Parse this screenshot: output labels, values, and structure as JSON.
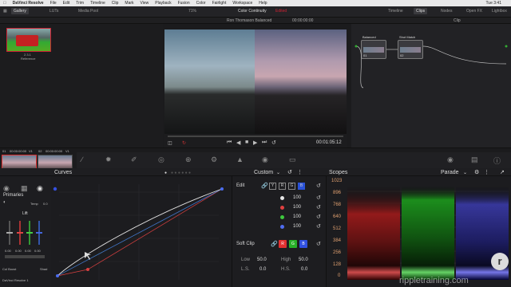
{
  "menubar": {
    "app": "DaVinci Resolve",
    "items": [
      "File",
      "Edit",
      "Trim",
      "Timeline",
      "Clip",
      "Mark",
      "View",
      "Playback",
      "Fusion",
      "Color",
      "Fairlight",
      "Workspace",
      "Help"
    ],
    "clock": "Tue 3:41"
  },
  "toolbar": {
    "gallery": "Gallery",
    "luts": "LUTs",
    "media_pool": "Media Pool",
    "zoom": "71%",
    "title": "Color Continuity",
    "edited": "Edited",
    "timeline": "Timeline",
    "clips": "Clips",
    "nodes": "Nodes",
    "openfx": "Open FX",
    "lightbox": "Lightbox"
  },
  "subbar": {
    "clip_name": "Ron Thomason Balanced",
    "timecode": "00:00:00:00",
    "mode": "Clip"
  },
  "gallery": {
    "still_id": "2.3.1",
    "still_label": "Reference"
  },
  "viewer": {
    "timecode": "00:01:05:12"
  },
  "nodes": {
    "node1_label": "Balanced",
    "node1_num": "01",
    "node2_label": "Shot Match",
    "node2_num": "02"
  },
  "clips": {
    "c1_num": "01",
    "c1_tc": "00:00:00:00",
    "c1_track": "V1",
    "c1_name": "Drone Evening A.mov",
    "c2_num": "02",
    "c2_tc": "00:00:00:00",
    "c2_track": "V1",
    "c2_name": "Drone"
  },
  "primaries": {
    "title": "Primaries",
    "temp_label": "Temp",
    "temp_value": "0.0",
    "lift_label": "Lift",
    "lift_values": [
      "0.00",
      "0.00",
      "0.00",
      "0.00"
    ],
    "col_boost": "Col Boost",
    "shad": "Shad",
    "footer": "DaVinci Resolve 1"
  },
  "curves": {
    "title": "Curves",
    "mode": "Custom"
  },
  "edit": {
    "title": "Edit",
    "channels": [
      "Y",
      "R",
      "G",
      "B"
    ],
    "values": [
      "100",
      "100",
      "100",
      "100"
    ],
    "channel_colors": [
      "#e6e6e6",
      "#e04040",
      "#3ec83e",
      "#4f6cf0"
    ]
  },
  "softclip": {
    "title": "Soft Clip",
    "channels": [
      "R",
      "G",
      "B"
    ],
    "channel_colors": [
      "#e03030",
      "#28b028",
      "#3050e0"
    ],
    "low_label": "Low",
    "low_value": "50.0",
    "high_label": "High",
    "high_value": "50.0",
    "ls_label": "L.S.",
    "ls_value": "0.0",
    "hs_label": "H.S.",
    "hs_value": "0.0"
  },
  "scopes": {
    "title": "Scopes",
    "mode": "Parade",
    "scale": [
      "1023",
      "896",
      "768",
      "640",
      "512",
      "384",
      "256",
      "128",
      "0"
    ]
  },
  "watermark": "rippletraining.com"
}
